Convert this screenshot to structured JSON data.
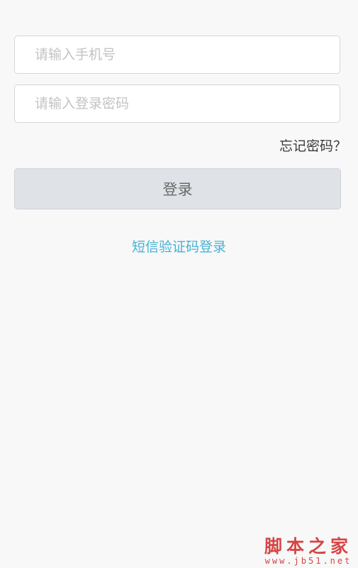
{
  "form": {
    "phone_placeholder": "请输入手机号",
    "phone_value": "",
    "password_placeholder": "请输入登录密码",
    "password_value": ""
  },
  "forgot_password_label": "忘记密码？",
  "login_button_label": "登录",
  "sms_login_label": "短信验证码登录",
  "watermark": {
    "main": "脚本之家",
    "sub": "www.jb51.net"
  },
  "colors": {
    "page_background": "#f8f8f8",
    "input_border": "#d6d6d6",
    "placeholder_text": "#c3c3c3",
    "button_background": "#dfe2e6",
    "button_text": "#6a6a6a",
    "link_blue": "#46b2d6",
    "watermark_red": "#d64545"
  }
}
